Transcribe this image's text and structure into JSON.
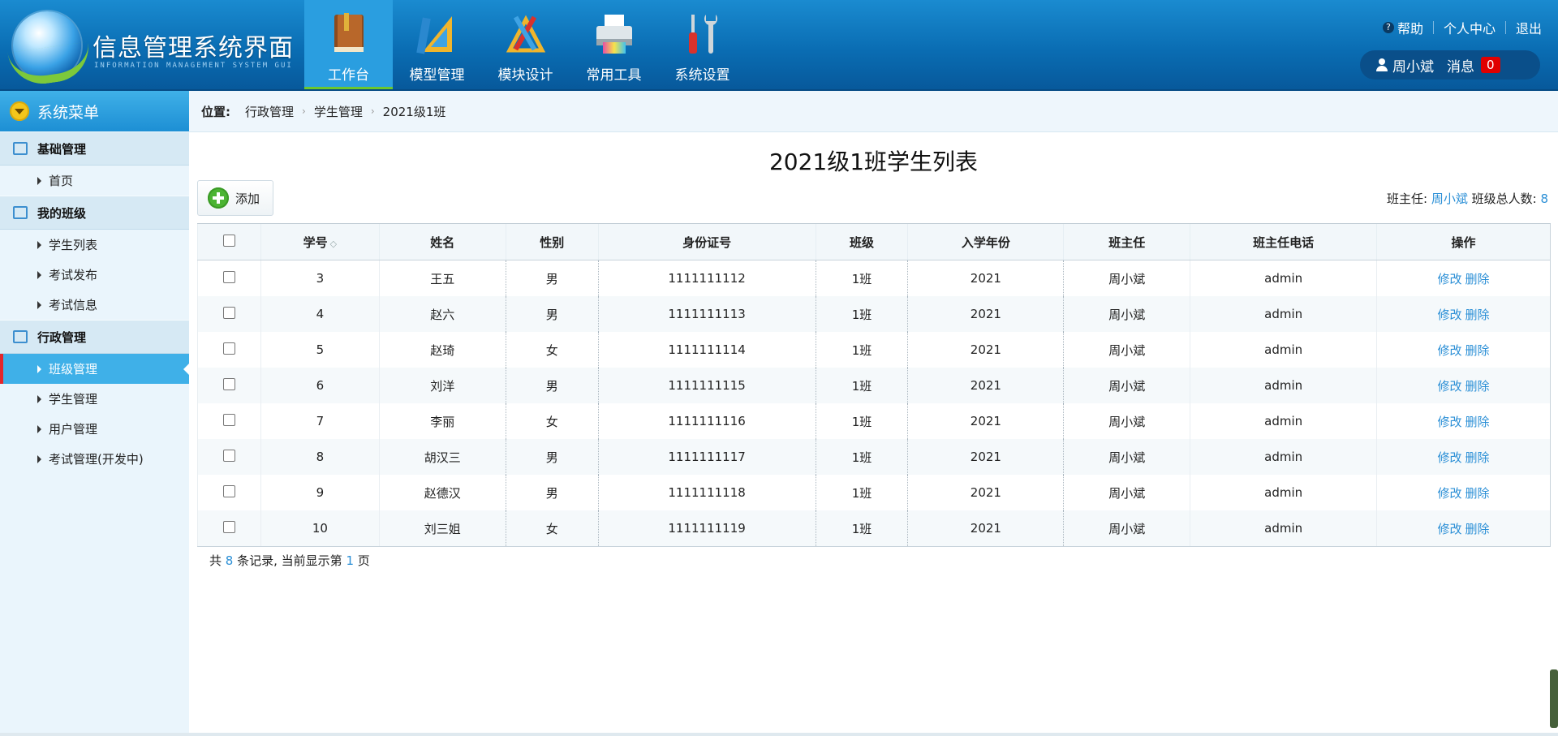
{
  "header": {
    "app_title": "信息管理系统界面",
    "app_subtitle": "INFORMATION MANAGEMENT SYSTEM GUI",
    "nav": [
      {
        "label": "工作台",
        "icon": "book-icon",
        "active": true
      },
      {
        "label": "模型管理",
        "icon": "ruler-triangle-icon",
        "active": false
      },
      {
        "label": "模块设计",
        "icon": "drafting-tools-icon",
        "active": false
      },
      {
        "label": "常用工具",
        "icon": "printer-icon",
        "active": false
      },
      {
        "label": "系统设置",
        "icon": "wrench-screwdriver-icon",
        "active": false
      }
    ],
    "links": {
      "help": "帮助",
      "personal_center": "个人中心",
      "logout": "退出"
    },
    "user": {
      "name": "周小斌",
      "message_label": "消息",
      "message_count": "0"
    }
  },
  "sidebar": {
    "title": "系统菜单",
    "groups": [
      {
        "label": "基础管理",
        "items": [
          {
            "label": "首页"
          }
        ]
      },
      {
        "label": "我的班级",
        "items": [
          {
            "label": "学生列表"
          },
          {
            "label": "考试发布"
          },
          {
            "label": "考试信息"
          }
        ]
      },
      {
        "label": "行政管理",
        "items": [
          {
            "label": "班级管理",
            "active": true
          },
          {
            "label": "学生管理"
          },
          {
            "label": "用户管理"
          },
          {
            "label": "考试管理(开发中)"
          }
        ]
      }
    ]
  },
  "breadcrumb": {
    "label": "位置:",
    "items": [
      "行政管理",
      "学生管理",
      "2021级1班"
    ]
  },
  "main": {
    "title": "2021级1班学生列表",
    "add_label": "添加",
    "class_info": {
      "teacher_label": "班主任:",
      "teacher": "周小斌",
      "total_label": "班级总人数:",
      "total": "8"
    },
    "columns": [
      "学号",
      "姓名",
      "性别",
      "身份证号",
      "班级",
      "入学年份",
      "班主任",
      "班主任电话",
      "操作"
    ],
    "rows": [
      {
        "id": "3",
        "name": "王五",
        "gender": "男",
        "id_card": "1111111112",
        "class": "1班",
        "year": "2021",
        "teacher": "周小斌",
        "phone": "admin"
      },
      {
        "id": "4",
        "name": "赵六",
        "gender": "男",
        "id_card": "1111111113",
        "class": "1班",
        "year": "2021",
        "teacher": "周小斌",
        "phone": "admin"
      },
      {
        "id": "5",
        "name": "赵琦",
        "gender": "女",
        "id_card": "1111111114",
        "class": "1班",
        "year": "2021",
        "teacher": "周小斌",
        "phone": "admin"
      },
      {
        "id": "6",
        "name": "刘洋",
        "gender": "男",
        "id_card": "1111111115",
        "class": "1班",
        "year": "2021",
        "teacher": "周小斌",
        "phone": "admin"
      },
      {
        "id": "7",
        "name": "李丽",
        "gender": "女",
        "id_card": "1111111116",
        "class": "1班",
        "year": "2021",
        "teacher": "周小斌",
        "phone": "admin"
      },
      {
        "id": "8",
        "name": "胡汉三",
        "gender": "男",
        "id_card": "1111111117",
        "class": "1班",
        "year": "2021",
        "teacher": "周小斌",
        "phone": "admin"
      },
      {
        "id": "9",
        "name": "赵德汉",
        "gender": "男",
        "id_card": "1111111118",
        "class": "1班",
        "year": "2021",
        "teacher": "周小斌",
        "phone": "admin"
      },
      {
        "id": "10",
        "name": "刘三姐",
        "gender": "女",
        "id_card": "1111111119",
        "class": "1班",
        "year": "2021",
        "teacher": "周小斌",
        "phone": "admin"
      }
    ],
    "actions": {
      "edit": "修改",
      "delete": "删除"
    },
    "footer": {
      "prefix": "共",
      "total": "8",
      "mid": "条记录, 当前显示第",
      "page": "1",
      "suffix": "页"
    }
  },
  "colors": {
    "accent": "#2b8fd6",
    "header_blue": "#0a6db3",
    "active_green": "#6bc72e",
    "badge_red": "#e00000"
  }
}
